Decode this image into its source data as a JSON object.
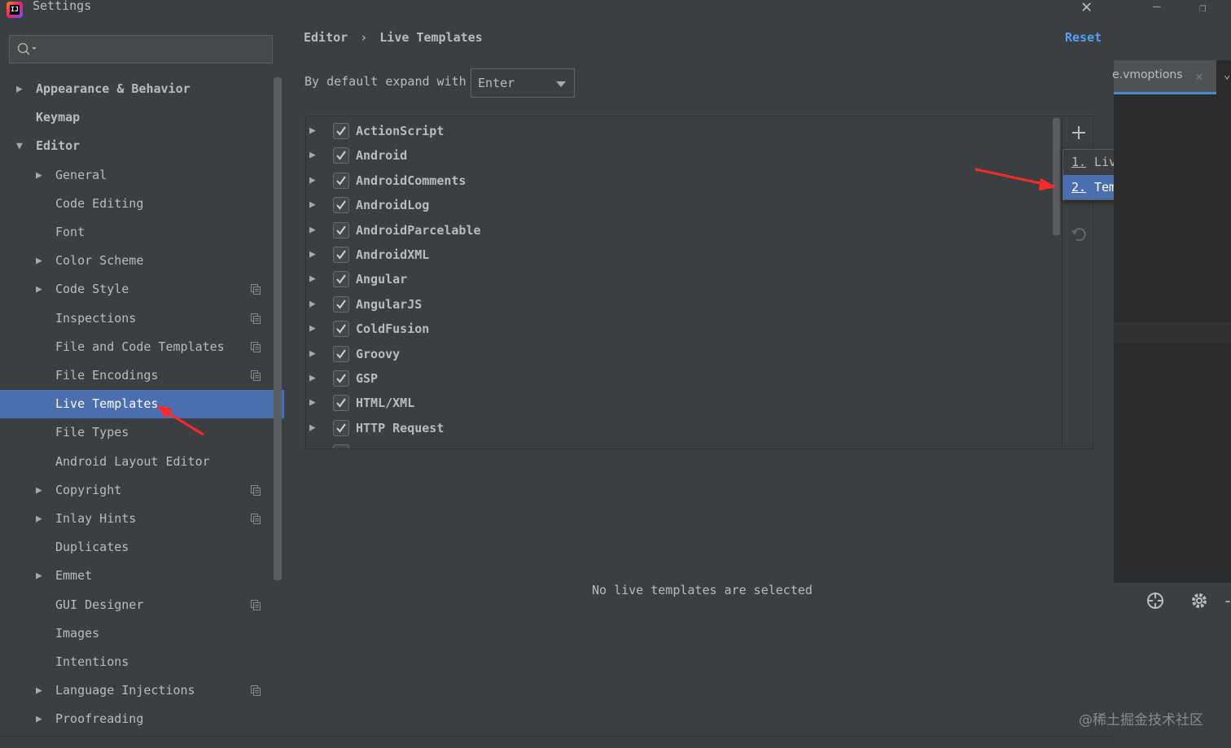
{
  "window": {
    "title": "Settings"
  },
  "sidebar": {
    "search_placeholder": "",
    "items": [
      {
        "label": "Appearance & Behavior",
        "expandable": true,
        "expanded": false,
        "bold": true,
        "level": 0
      },
      {
        "label": "Keymap",
        "expandable": false,
        "bold": true,
        "level": 0
      },
      {
        "label": "Editor",
        "expandable": true,
        "expanded": true,
        "bold": true,
        "level": 0
      },
      {
        "label": "General",
        "expandable": true,
        "expanded": false,
        "level": 1
      },
      {
        "label": "Code Editing",
        "expandable": false,
        "level": 1
      },
      {
        "label": "Font",
        "expandable": false,
        "level": 1
      },
      {
        "label": "Color Scheme",
        "expandable": true,
        "expanded": false,
        "level": 1
      },
      {
        "label": "Code Style",
        "expandable": true,
        "expanded": false,
        "level": 1,
        "project_icon": true
      },
      {
        "label": "Inspections",
        "expandable": false,
        "level": 1,
        "project_icon": true
      },
      {
        "label": "File and Code Templates",
        "expandable": false,
        "level": 1,
        "project_icon": true
      },
      {
        "label": "File Encodings",
        "expandable": false,
        "level": 1,
        "project_icon": true
      },
      {
        "label": "Live Templates",
        "expandable": false,
        "level": 1,
        "selected": true
      },
      {
        "label": "File Types",
        "expandable": false,
        "level": 1
      },
      {
        "label": "Android Layout Editor",
        "expandable": false,
        "level": 1
      },
      {
        "label": "Copyright",
        "expandable": true,
        "expanded": false,
        "level": 1,
        "project_icon": true
      },
      {
        "label": "Inlay Hints",
        "expandable": true,
        "expanded": false,
        "level": 1,
        "project_icon": true
      },
      {
        "label": "Duplicates",
        "expandable": false,
        "level": 1
      },
      {
        "label": "Emmet",
        "expandable": true,
        "expanded": false,
        "level": 1
      },
      {
        "label": "GUI Designer",
        "expandable": false,
        "level": 1,
        "project_icon": true
      },
      {
        "label": "Images",
        "expandable": false,
        "level": 1
      },
      {
        "label": "Intentions",
        "expandable": false,
        "level": 1
      },
      {
        "label": "Language Injections",
        "expandable": true,
        "expanded": false,
        "level": 1,
        "project_icon": true
      },
      {
        "label": "Proofreading",
        "expandable": true,
        "expanded": false,
        "level": 1
      }
    ]
  },
  "header": {
    "breadcrumb_parent": "Editor",
    "breadcrumb_sep": "›",
    "breadcrumb_current": "Live Templates",
    "reset_label": "Reset"
  },
  "expand": {
    "label": "By default expand with",
    "selected": "Enter"
  },
  "template_groups": [
    {
      "name": "ActionScript",
      "checked": true
    },
    {
      "name": "Android",
      "checked": true
    },
    {
      "name": "AndroidComments",
      "checked": true
    },
    {
      "name": "AndroidLog",
      "checked": true
    },
    {
      "name": "AndroidParcelable",
      "checked": true
    },
    {
      "name": "AndroidXML",
      "checked": true
    },
    {
      "name": "Angular",
      "checked": true
    },
    {
      "name": "AngularJS",
      "checked": true
    },
    {
      "name": "ColdFusion",
      "checked": true
    },
    {
      "name": "Groovy",
      "checked": true
    },
    {
      "name": "GSP",
      "checked": true
    },
    {
      "name": "HTML/XML",
      "checked": true
    },
    {
      "name": "HTTP Request",
      "checked": true
    }
  ],
  "add_menu": {
    "items": [
      {
        "num": "1.",
        "label": "Live Template",
        "selected": false
      },
      {
        "num": "2.",
        "label": "Template Group...",
        "selected": true
      }
    ]
  },
  "empty_message": "No live templates are selected",
  "background_ide": {
    "tab_label": "e.vmoptions"
  },
  "watermark": "@稀土掘金技术社区",
  "colors": {
    "background": "#3c3f41",
    "selection": "#4b6eaf",
    "link": "#589df6",
    "annotation_arrow": "#ff2a2a"
  }
}
